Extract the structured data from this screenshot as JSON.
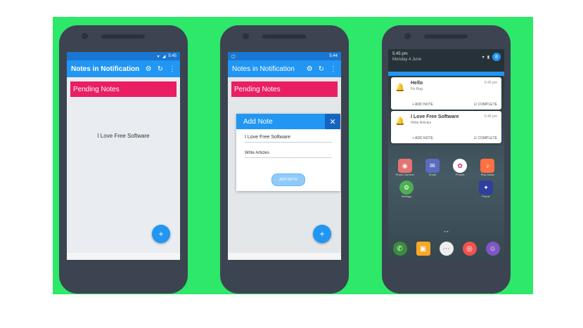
{
  "phone1": {
    "app_title": "Notes in Notification",
    "status_time": "5:45",
    "section_title": "Pending Notes",
    "note": "I Love Free Software",
    "fab": "+"
  },
  "phone2": {
    "app_title": "Notes in Notification",
    "status_time": "5:44",
    "section_title": "Pending Notes",
    "dialog_title": "Add Note",
    "dialog_close": "✕",
    "field_title": "I Love Free Software",
    "field_body": "Write Articles",
    "add_button": "ADD NOTE",
    "fab": "+"
  },
  "phone3": {
    "time": "5:45 pm",
    "date": "Monday 4 June",
    "avatar_letter": "8",
    "notifications": [
      {
        "title": "Hello",
        "subtitle": "Fix Bug",
        "time": "5:45 pm",
        "action_add": "ADD NOTE",
        "action_complete": "COMPLETE"
      },
      {
        "title": "I Love Free Software",
        "subtitle": "Write Articles",
        "time": "5:45 pm",
        "action_add": "ADD NOTE",
        "action_complete": "COMPLETE"
      }
    ],
    "apps": [
      "Photo Camera",
      "Email",
      "Photos",
      "Play Music",
      "Settings",
      "Phone"
    ]
  }
}
